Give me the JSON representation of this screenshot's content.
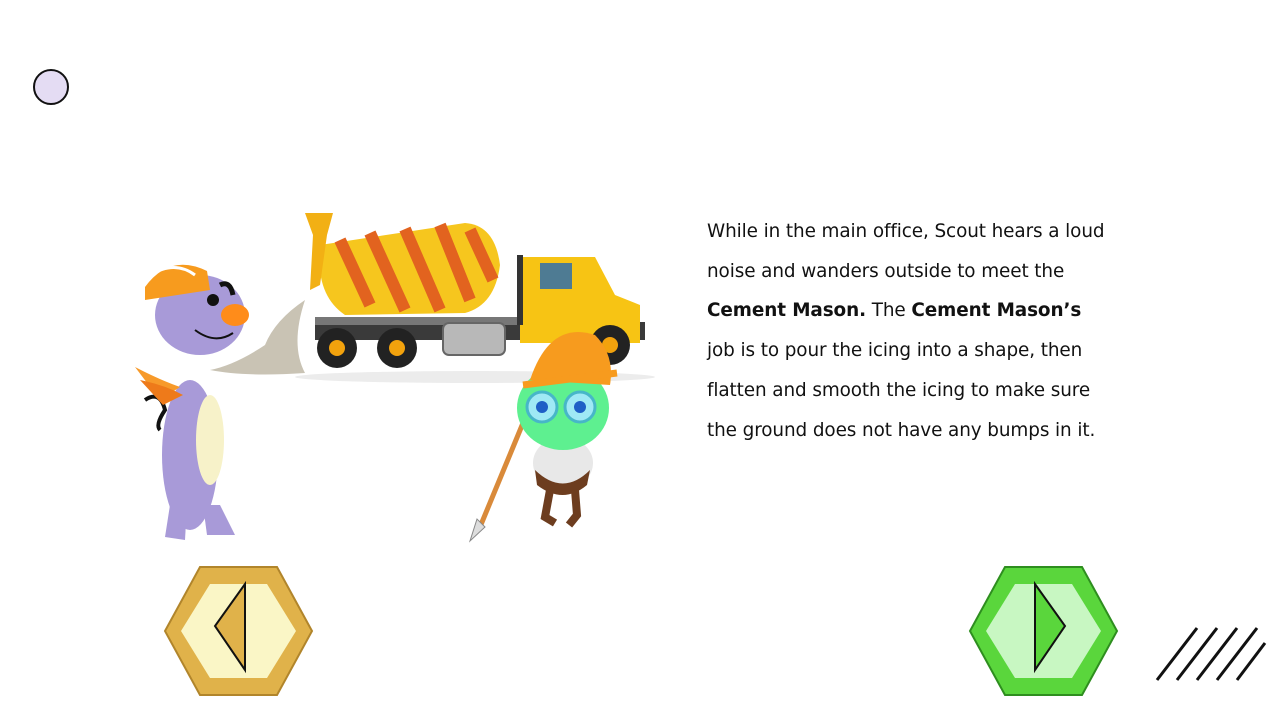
{
  "page": {
    "story": {
      "segments": [
        {
          "text": "While in the main office, Scout hears a loud noise and wanders outside to meet the ",
          "bold": false
        },
        {
          "text": "Cement Mason.",
          "bold": true
        },
        {
          "text": " The ",
          "bold": false
        },
        {
          "text": "Cement Mason’s",
          "bold": true
        },
        {
          "text": " job is to pour the icing into a shape, then flatten and smooth the icing to make sure the ground does not have any bumps in it.",
          "bold": false
        }
      ]
    },
    "illustration": {
      "characters": [
        "purple-dog-with-hard-hat",
        "green-robot-with-hard-hat"
      ],
      "vehicle": "cement-mixer-truck"
    },
    "navigation": {
      "prev_icon": "left-triangle-icon",
      "next_icon": "right-triangle-icon"
    },
    "colors": {
      "prev_outer": "#e0b24a",
      "prev_inner": "#faf6c6",
      "next_outer": "#5ad63c",
      "next_inner": "#c8f7c2",
      "status_circle": "#e4dcf3"
    }
  }
}
